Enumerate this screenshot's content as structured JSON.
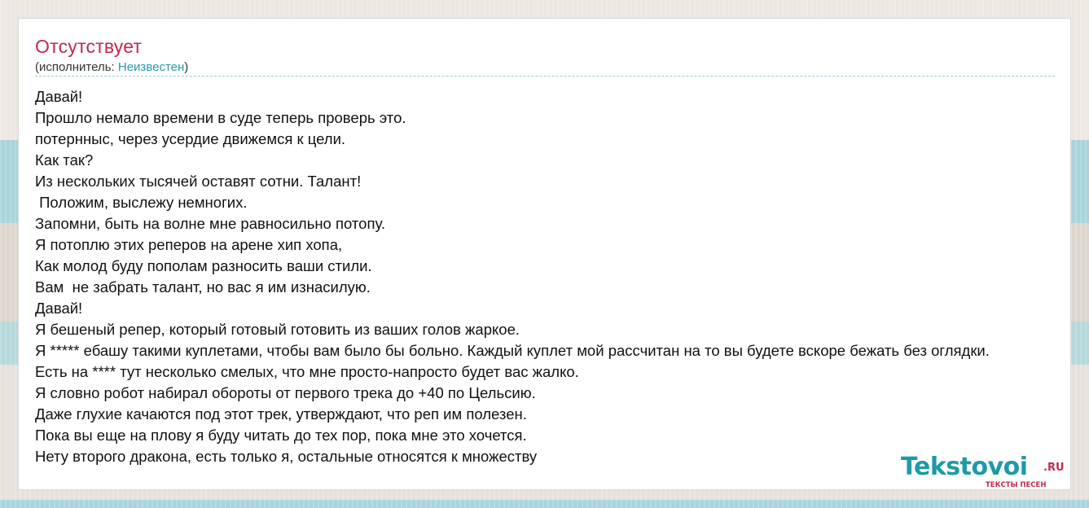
{
  "song": {
    "title": "Отсутствует",
    "artist_prefix": "(исполнитель: ",
    "artist_name": "Неизвестен",
    "artist_suffix": ")"
  },
  "lyrics": [
    "Давай!",
    "Прошло немало времени в суде теперь проверь это.",
    "потернныс, через усердие движемся к цели.",
    "Как так?",
    "Из нескольких тысячей оставят сотни. Талант!",
    " Положим, выслежу немногих.",
    "Запомни, быть на волне мне равносильно потопу.",
    "Я потоплю этих реперов на арене хип хопа,",
    "Как молод буду пополам разносить ваши стили.",
    "Вам  не забрать талант, но вас я им изнасилую.",
    "Давай!",
    "Я бешеный репер, который готовый готовить из ваших голов жаркое.",
    "Я ***** ебашу такими куплетами, чтобы вам было бы больно. Каждый куплет мой рассчитан на то вы будете вскоре бежать без оглядки.",
    "Есть на **** тут несколько смелых, что мне просто-напросто будет вас жалко.",
    "Я словно робот набирал обороты от первого трека до +40 по Цельсию.",
    "Даже глухие качаются под этот трек, утверждают, что реп им полезен.",
    "Пока вы еще на плову я буду читать до тех пор, пока мне это хочется.",
    "Нету второго дракона, есть только я, остальные относятся к множеству"
  ],
  "logo": {
    "main": "Tekstovoi",
    "tld": ".RU",
    "tagline": "ТЕКСТЫ ПЕСЕН"
  },
  "colors": {
    "title": "#c0294f",
    "link": "#2a9aa7",
    "logo_main": "#1d9aa6",
    "logo_accent": "#c0294f"
  }
}
